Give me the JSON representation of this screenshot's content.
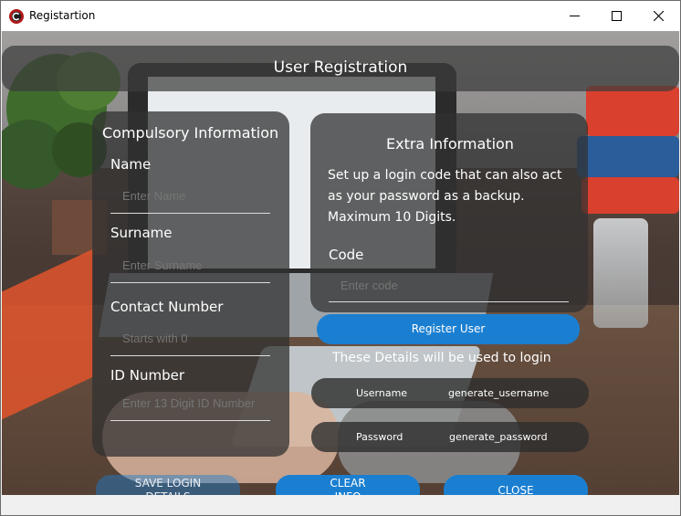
{
  "window": {
    "title": "Registartion",
    "controls": {
      "minimize": "minimize-icon",
      "maximize": "maximize-icon",
      "close": "close-icon"
    }
  },
  "header": {
    "title": "User Registration"
  },
  "compulsory": {
    "title": "Compulsory Information",
    "name": {
      "label": "Name",
      "placeholder": "Enter Name"
    },
    "surname": {
      "label": "Surname",
      "placeholder": "Enter Surname"
    },
    "contact": {
      "label": "Contact Number",
      "placeholder": "Starts with 0"
    },
    "id_number": {
      "label": "ID Number",
      "placeholder": "Enter 13 Digit ID Number"
    }
  },
  "extra": {
    "title": "Extra Information",
    "description_lines": [
      "Set up a login code that can also act",
      "as your password as a backup.",
      "Maximum 10 Digits."
    ],
    "code": {
      "label": "Code",
      "placeholder": "Enter code"
    }
  },
  "register_button": "Register User",
  "login_info": "These Details will be used to login",
  "username_row": {
    "label": "Username",
    "value": "generate_username"
  },
  "password_row": {
    "label": "Password",
    "value": "generate_password"
  },
  "buttons": {
    "save_login_line1": "SAVE LOGIN",
    "save_login_line2": "DETAILS",
    "clear_line1": "CLEAR",
    "clear_line2": "INFO",
    "close": "CLOSE"
  },
  "colors": {
    "accent": "#1b7fd1",
    "panel": "#323232"
  }
}
